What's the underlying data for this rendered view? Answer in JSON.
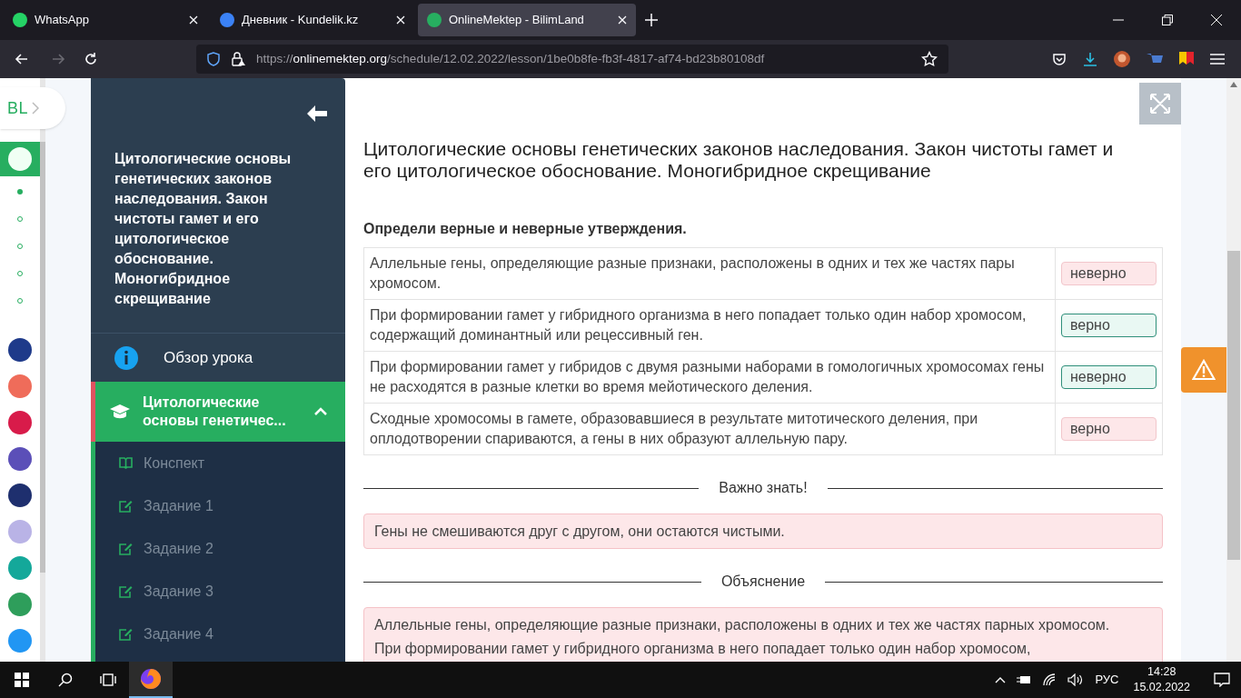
{
  "browser": {
    "tabs": [
      {
        "label": "WhatsApp",
        "selected": false,
        "color": "#25d366"
      },
      {
        "label": "Дневник - Kundelik.kz",
        "selected": false,
        "color": "#3b82f6"
      },
      {
        "label": "OnlineMektep - BilimLand",
        "selected": true,
        "color": "#27ae60"
      }
    ],
    "url": {
      "host_prefix": "https://",
      "host": "onlinemektep.org",
      "path": "/schedule/12.02.2022/lesson/1be0b8fe-fb3f-4817-af74-bd23b80108df"
    }
  },
  "rail": {
    "logo": "BL",
    "dots": [
      {
        "selected": true
      },
      {
        "selected": false
      },
      {
        "selected": false
      },
      {
        "selected": false
      },
      {
        "selected": false
      }
    ],
    "apps": [
      {
        "color": "#1e3a8a"
      },
      {
        "color": "#ef6c5a"
      },
      {
        "color": "#d81b4a"
      },
      {
        "color": "#5b4fb8"
      },
      {
        "color": "#1e2f6e"
      },
      {
        "color": "#b9b3e6"
      },
      {
        "color": "#14a89a"
      },
      {
        "color": "#2e9e5b"
      },
      {
        "color": "#2196f3"
      }
    ]
  },
  "sidebar": {
    "title": "Цитологические основы генетических законов наследования. Закон чистоты гамет и его цитологическое обоснование. Моногибридное скрещивание",
    "overview": "Обзор урока",
    "section": {
      "label": "Цитологические основы генетичес...",
      "expanded": true,
      "items": [
        {
          "kind": "notes",
          "label": "Конспект"
        },
        {
          "kind": "task",
          "label": "Задание 1"
        },
        {
          "kind": "task",
          "label": "Задание 2"
        },
        {
          "kind": "task",
          "label": "Задание 3"
        },
        {
          "kind": "task",
          "label": "Задание 4"
        }
      ]
    }
  },
  "lesson": {
    "title": "Цитологические основы генетических законов наследования. Закон чистоты гамет и его цитологическое обоснование. Моногибридное скрещивание",
    "question": "Определи верные и неверные утверждения.",
    "rows": [
      {
        "statement": "Аллельные гены, определяющие разные признаки, расположены в одних и тех же частях пары хромосом.",
        "answer": "неверно",
        "correct": false
      },
      {
        "statement": "При формировании гамет у гибридного организма в него попадает только один набор хромосом, содержащий доминантный или рецессивный ген.",
        "answer": "верно",
        "correct": true
      },
      {
        "statement": "При формировании гамет у гибридов с двумя разными наборами в гомологичных хромосомах гены не расходятся в разные клетки во время мейотического деления.",
        "answer": "неверно",
        "correct": true
      },
      {
        "statement": "Сходные хромосомы в гамете, образовавшиеся в результате митотического деления, при оплодотворении спариваются, а гены в них образуют аллельную пару.",
        "answer": "верно",
        "correct": false
      }
    ],
    "important_heading": "Важно знать!",
    "important_text": "Гены не смешиваются друг с другом, они остаются чистыми.",
    "explanation_heading": "Объяснение",
    "explanation": [
      "Аллельные гены, определяющие разные признаки, расположены в одних и тех же частях парных хромосом.",
      "При формировании гамет у гибридного организма в него попадает только один набор хромосом,"
    ]
  },
  "taskbar": {
    "language": "РУС",
    "time": "14:28",
    "date": "15.02.2022"
  }
}
